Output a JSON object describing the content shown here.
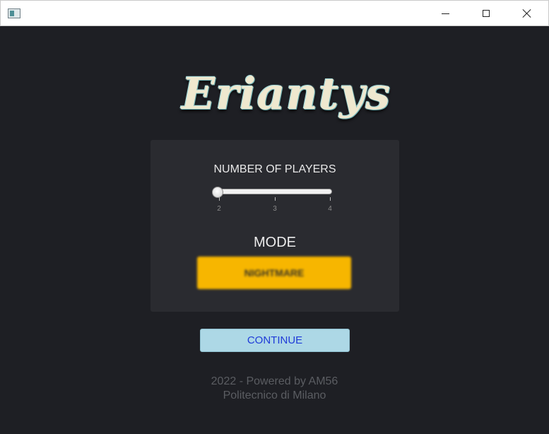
{
  "window": {
    "icon": "app-window-icon",
    "controls": [
      "minimize-icon",
      "maximize-icon",
      "close-icon"
    ]
  },
  "logo": {
    "text": "Eriantys"
  },
  "players": {
    "label": "NUMBER OF PLAYERS",
    "value": 2,
    "ticks": [
      "2",
      "3",
      "4"
    ]
  },
  "mode": {
    "label": "MODE",
    "button_text": "NIGHTMARE",
    "color": "#f7b600"
  },
  "continue_label": "CONTINUE",
  "footer": {
    "line1": "2022 - Powered by AM56",
    "line2": "Politecnico di Milano"
  },
  "colors": {
    "background": "#1e1f24",
    "panel": "#2a2b30",
    "continue_bg": "#add8e6",
    "continue_text": "#1f3bd8"
  }
}
